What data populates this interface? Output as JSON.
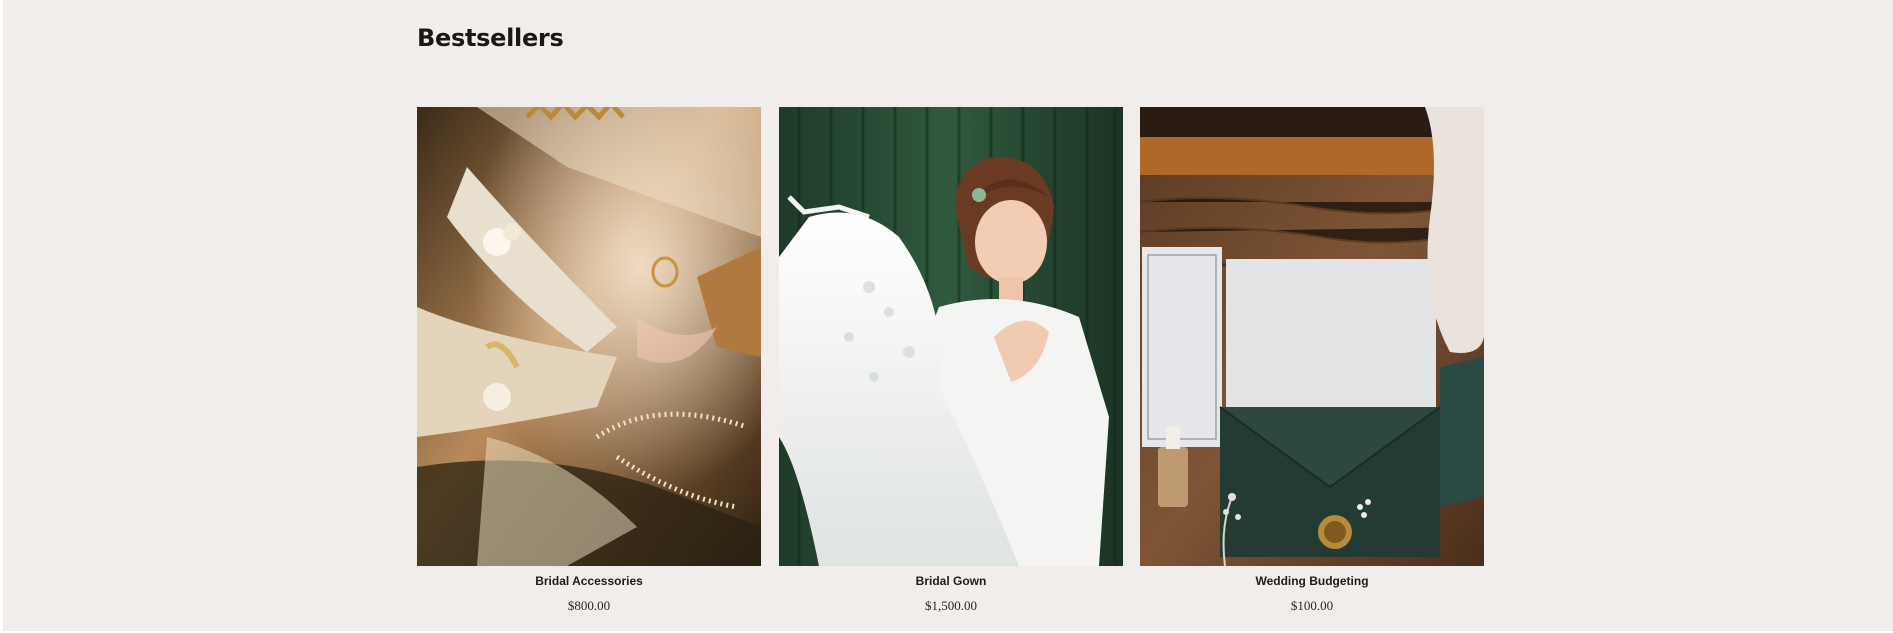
{
  "section": {
    "title": "Bestsellers"
  },
  "products": [
    {
      "name": "Bridal Accessories",
      "price": "$800.00",
      "image": "bridal-accessories-photo"
    },
    {
      "name": "Bridal Gown",
      "price": "$1,500.00",
      "image": "bridal-gown-photo"
    },
    {
      "name": "Wedding Budgeting",
      "price": "$100.00",
      "image": "wedding-budgeting-photo"
    }
  ],
  "colors": {
    "page_background": "#f1edea",
    "heading_text": "#1a1816"
  }
}
